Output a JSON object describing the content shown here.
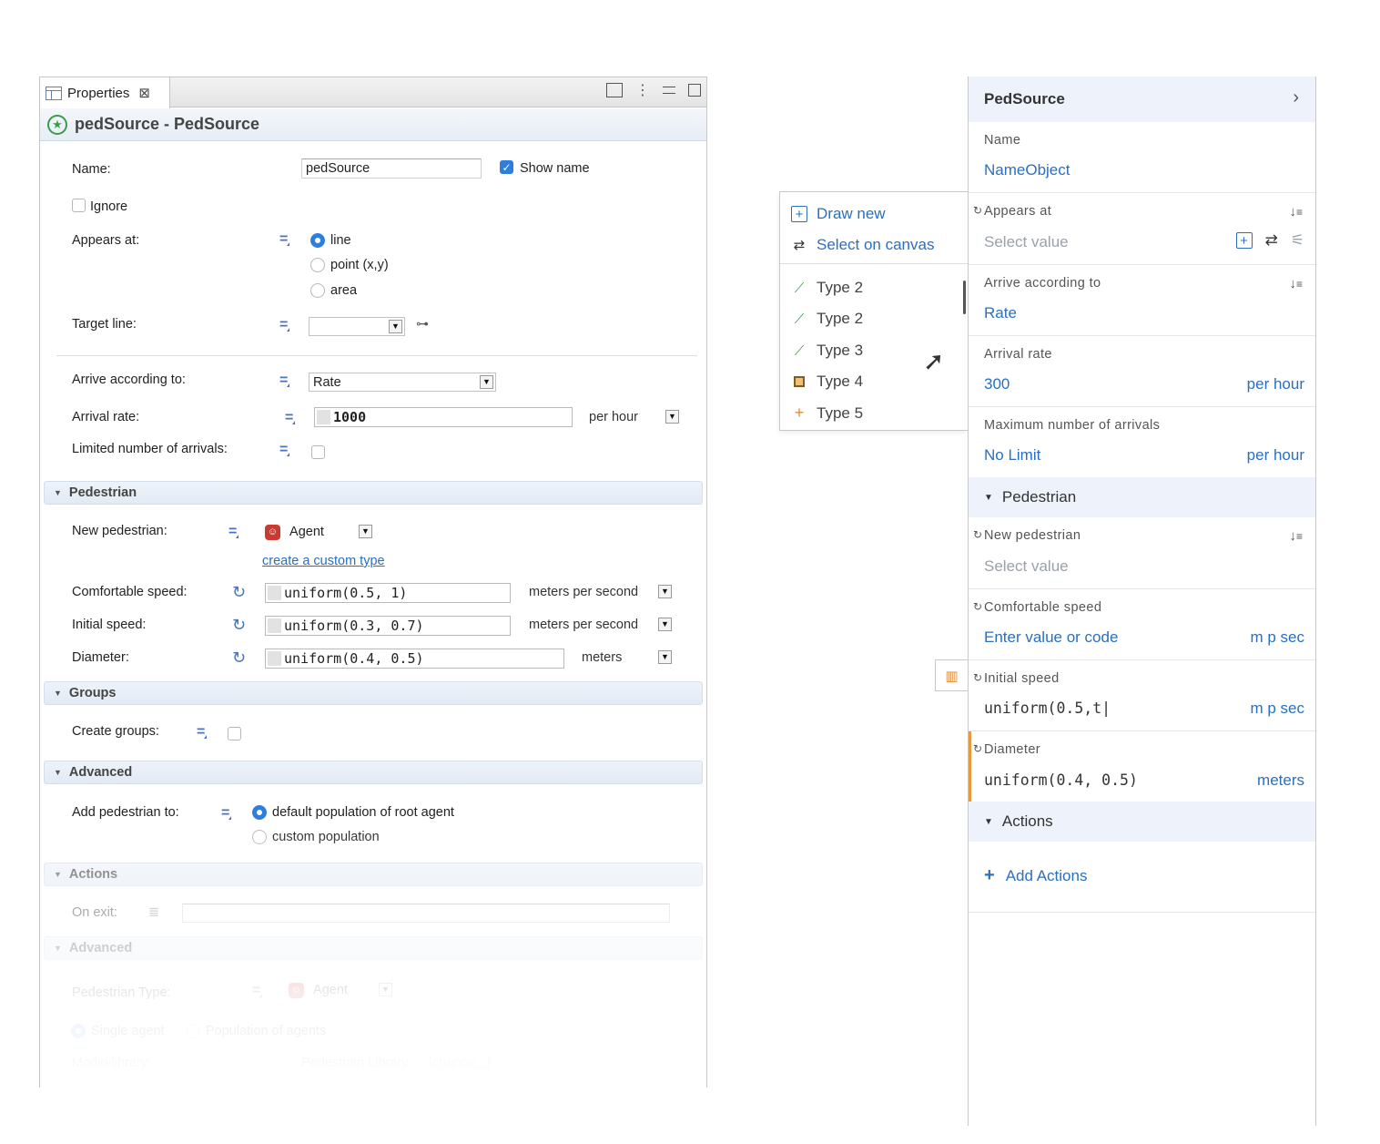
{
  "left": {
    "tab_label": "Properties",
    "tab_close": "⊠",
    "title": "pedSource - PedSource",
    "name_label": "Name:",
    "name_value": "pedSource",
    "show_name_label": "Show name",
    "show_name_checked": true,
    "ignore_label": "Ignore",
    "appears_at_label": "Appears at:",
    "appears_options": [
      "line",
      "point (x,y)",
      "area"
    ],
    "appears_selected": "line",
    "target_line_label": "Target line:",
    "target_line_value": "",
    "arrive_label": "Arrive according to:",
    "arrive_value": "Rate",
    "arrival_rate_label": "Arrival rate:",
    "arrival_rate_value": "1000",
    "arrival_rate_unit": "per hour",
    "limited_label": "Limited number of arrivals:",
    "section_pedestrian": "Pedestrian",
    "new_ped_label": "New pedestrian:",
    "new_ped_value": "Agent",
    "create_custom_link": "create a custom type",
    "comfort_label": "Comfortable speed:",
    "comfort_value": "uniform(0.5, 1)",
    "comfort_unit": "meters per second",
    "initial_label": "Initial speed:",
    "initial_value": "uniform(0.3, 0.7)",
    "initial_unit": "meters per second",
    "diameter_label": "Diameter:",
    "diameter_value": "uniform(0.4, 0.5)",
    "diameter_unit": "meters",
    "section_groups": "Groups",
    "create_groups_label": "Create groups:",
    "section_advanced": "Advanced",
    "add_ped_label": "Add pedestrian to:",
    "add_ped_options": [
      "default population of root agent",
      "custom population"
    ],
    "section_actions": "Actions",
    "on_exit_label": "On exit:",
    "section_advanced2": "Advanced",
    "ped_type_label": "Pedestrian Type:",
    "ped_type_value": "Agent",
    "single_agent_label": "Single agent",
    "population_label": "Population of agents",
    "model_library_label": "Model/library:",
    "model_library_value": "Pedestrian Library",
    "change_link": "[change...]"
  },
  "dropdown": {
    "draw_new": "Draw new",
    "select_on_canvas": "Select on canvas",
    "items": [
      "Type 2",
      "Type 2",
      "Type 3",
      "Type 4",
      "Type 5"
    ]
  },
  "right": {
    "header_title": "PedSource",
    "name_label": "Name",
    "name_value": "NameObject",
    "appears_label": "Appears at",
    "appears_placeholder": "Select value",
    "arrive_label": "Arrive according to",
    "arrive_value": "Rate",
    "arrival_rate_label": "Arrival rate",
    "arrival_rate_value": "300",
    "arrival_rate_unit": "per hour",
    "max_arrivals_label": "Maximum number of arrivals",
    "max_arrivals_value": "No Limit",
    "max_arrivals_unit": "per hour",
    "section_pedestrian": "Pedestrian",
    "new_ped_label": "New pedestrian",
    "new_ped_placeholder": "Select value",
    "comfort_label": "Comfortable speed",
    "comfort_placeholder": "Enter value or code",
    "comfort_unit": "m p sec",
    "initial_label": "Initial speed",
    "initial_value": "uniform(0.5,t|",
    "initial_unit": "m p sec",
    "diameter_label": "Diameter",
    "diameter_value": "uniform(0.4, 0.5)",
    "diameter_unit": "meters",
    "section_actions": "Actions",
    "add_actions": "Add Actions"
  },
  "colors": {
    "accent": "#2a6fc0",
    "focus": "#e8983e",
    "section_bg": "#eef3fb"
  }
}
